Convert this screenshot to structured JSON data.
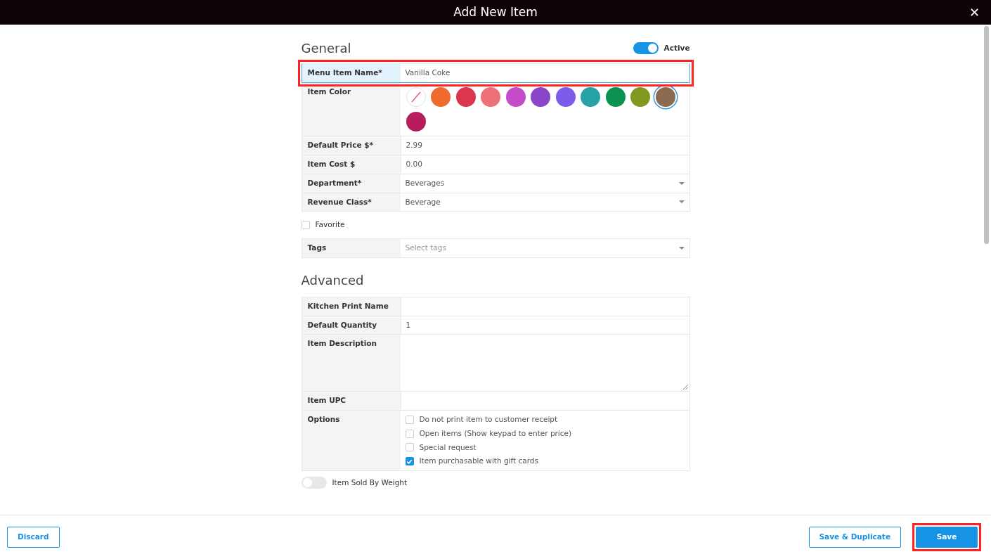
{
  "window": {
    "title": "Add New Item",
    "close": "✕"
  },
  "general": {
    "heading": "General",
    "active": {
      "label": "Active",
      "on": true
    },
    "name_row": {
      "label": "Menu Item Name*",
      "value": "Vanilla Coke",
      "highlighted": true
    },
    "item_color": {
      "label": "Item Color",
      "swatches": [
        {
          "kind": "none",
          "selected": false
        },
        {
          "color": "#ef6a2e",
          "selected": false
        },
        {
          "color": "#dc3550",
          "selected": false
        },
        {
          "color": "#f07078",
          "selected": false
        },
        {
          "color": "#c44cc8",
          "selected": false
        },
        {
          "color": "#8a45c8",
          "selected": false
        },
        {
          "color": "#7c5ce8",
          "selected": false
        },
        {
          "color": "#27a3a8",
          "selected": false
        },
        {
          "color": "#0b9150",
          "selected": false
        },
        {
          "color": "#7f9a1e",
          "selected": false
        },
        {
          "color": "#8c6a4f",
          "selected": true
        },
        {
          "color": "#b81c5f",
          "selected": false
        }
      ]
    },
    "fields": [
      {
        "kind": "text",
        "label": "Default Price $*",
        "value": "2.99"
      },
      {
        "kind": "text",
        "label": "Item Cost $",
        "value": "0.00"
      },
      {
        "kind": "select",
        "label": "Department*",
        "value": "Beverages"
      },
      {
        "kind": "select",
        "label": "Revenue Class*",
        "value": "Beverage"
      }
    ],
    "favorite": {
      "label": "Favorite",
      "checked": false
    },
    "tags": {
      "label": "Tags",
      "placeholder": "Select tags"
    }
  },
  "advanced": {
    "heading": "Advanced",
    "fields": [
      {
        "kind": "text",
        "label": "Kitchen Print Name"
      },
      {
        "kind": "text",
        "label": "Default Quantity",
        "value": "1"
      },
      {
        "kind": "textarea",
        "label": "Item Description"
      },
      {
        "kind": "text",
        "label": "Item UPC"
      }
    ],
    "options": {
      "label": "Options",
      "items": [
        {
          "label": "Do not print item to customer receipt",
          "checked": false
        },
        {
          "label": "Open items (Show keypad to enter price)",
          "checked": false
        },
        {
          "label": "Special request",
          "checked": false
        },
        {
          "label": "Item purchasable with gift cards",
          "checked": true
        }
      ]
    },
    "sold_by_weight": {
      "label": "Item Sold By Weight",
      "on": false
    }
  },
  "footer": {
    "discard": "Discard",
    "save_duplicate": "Save & Duplicate",
    "save": {
      "label": "Save",
      "highlighted": true
    }
  }
}
